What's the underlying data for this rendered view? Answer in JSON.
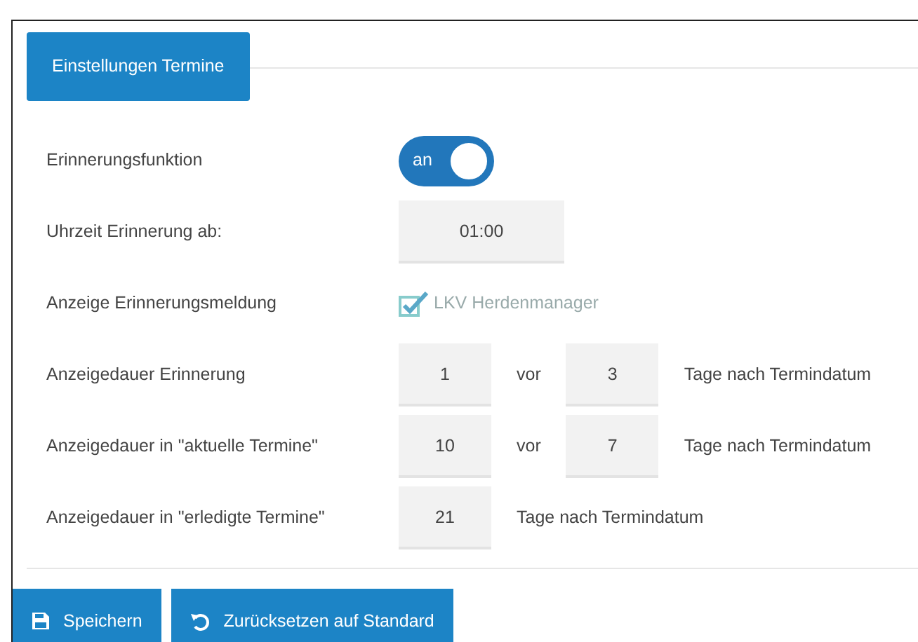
{
  "tab": {
    "label": "Einstellungen Termine",
    "selected": true
  },
  "rows": [
    {
      "label": "Erinnerungsfunktion",
      "items": [
        {
          "kind": "switch",
          "text": "an",
          "on": true
        }
      ]
    },
    {
      "label": "Uhrzeit Erinnerung ab:",
      "items": [
        {
          "kind": "input",
          "value": "01:00"
        }
      ]
    },
    {
      "label": "Anzeige Erinnerungsmeldung",
      "items": [
        {
          "kind": "checkbox",
          "text": "LKV Herdenmanager",
          "checked": true
        }
      ]
    },
    {
      "label": "Anzeigedauer Erinnerung",
      "items": [
        {
          "kind": "input",
          "value": "1"
        },
        {
          "kind": "text",
          "text": "vor"
        },
        {
          "kind": "input",
          "value": "3"
        },
        {
          "kind": "text",
          "text": "Tage nach Termindatum"
        }
      ]
    },
    {
      "label": "Anzeigedauer in \"aktuelle Termine\"",
      "items": [
        {
          "kind": "input",
          "value": "10"
        },
        {
          "kind": "text",
          "text": "vor"
        },
        {
          "kind": "input",
          "value": "7"
        },
        {
          "kind": "text",
          "text": "Tage nach Termindatum"
        }
      ]
    },
    {
      "label": "Anzeigedauer in \"erledigte Termine\"",
      "items": [
        {
          "kind": "input",
          "value": "21"
        },
        {
          "kind": "text",
          "text": "Tage nach Termindatum"
        }
      ]
    }
  ],
  "buttons": [
    {
      "label": "Speichern",
      "kind": "save"
    },
    {
      "label": "Zurücksetzen auf Standard",
      "kind": "reset"
    }
  ]
}
